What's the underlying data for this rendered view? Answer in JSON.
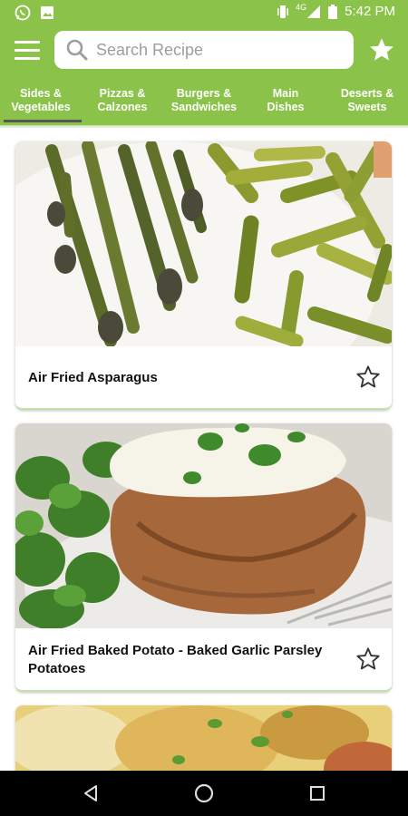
{
  "status_bar": {
    "time": "5:42 PM",
    "network": "4G",
    "icons": [
      "whatsapp-icon",
      "image-icon",
      "vibrate-icon",
      "signal-icon",
      "battery-icon"
    ]
  },
  "app_bar": {
    "menu_icon": "menu-icon",
    "search": {
      "placeholder": "Search Recipe"
    },
    "favorite_icon": "star-icon"
  },
  "tabs": [
    {
      "line1": "Sides &",
      "line2": "Vegetables",
      "active": true
    },
    {
      "line1": "Pizzas &",
      "line2": "Calzones",
      "active": false
    },
    {
      "line1": "Burgers &",
      "line2": "Sandwiches",
      "active": false
    },
    {
      "line1": "Main",
      "line2": "Dishes",
      "active": false
    },
    {
      "line1": "Deserts &",
      "line2": "Sweets",
      "active": false
    }
  ],
  "recipes": [
    {
      "title": "Air Fried Asparagus"
    },
    {
      "title": "Air Fried Baked Potato - Baked Garlic Parsley Potatoes"
    }
  ],
  "colors": {
    "primary": "#8bc34a",
    "card_accent": "#c5e1a5"
  },
  "nav_bar": {
    "icons": [
      "back-icon",
      "home-icon",
      "recents-icon"
    ]
  }
}
